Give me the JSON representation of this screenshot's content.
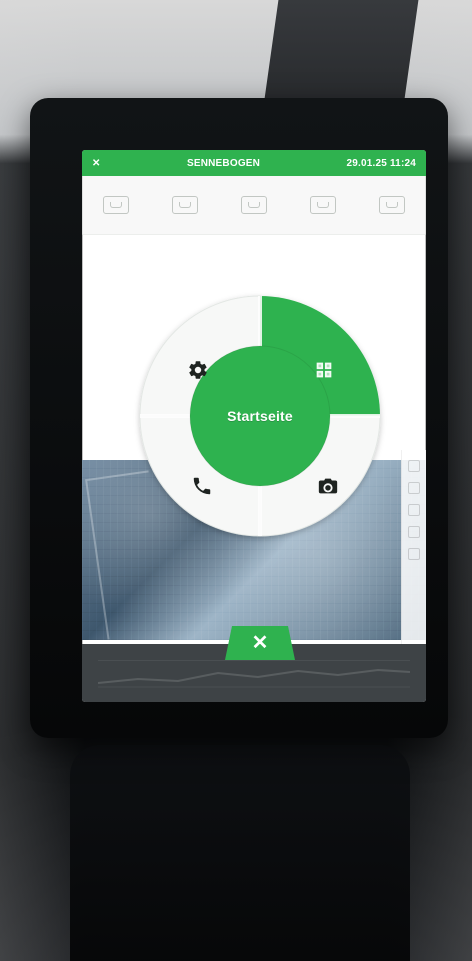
{
  "status_bar": {
    "left_symbol": "✕",
    "brand": "SENNEBOGEN",
    "datetime": "29.01.25 11:24"
  },
  "radial_menu": {
    "center_label": "Startseite"
  },
  "bottom_bar": {
    "close_symbol": "✕"
  },
  "colors": {
    "accent": "#2fb24f",
    "screen_bg": "#ffffff",
    "bottom_bar": "#3e4346"
  },
  "icons": {
    "settings": "gear-icon",
    "tiles": "grid-icon",
    "phone": "phone-icon",
    "camera": "camera-icon",
    "close": "close-icon"
  }
}
